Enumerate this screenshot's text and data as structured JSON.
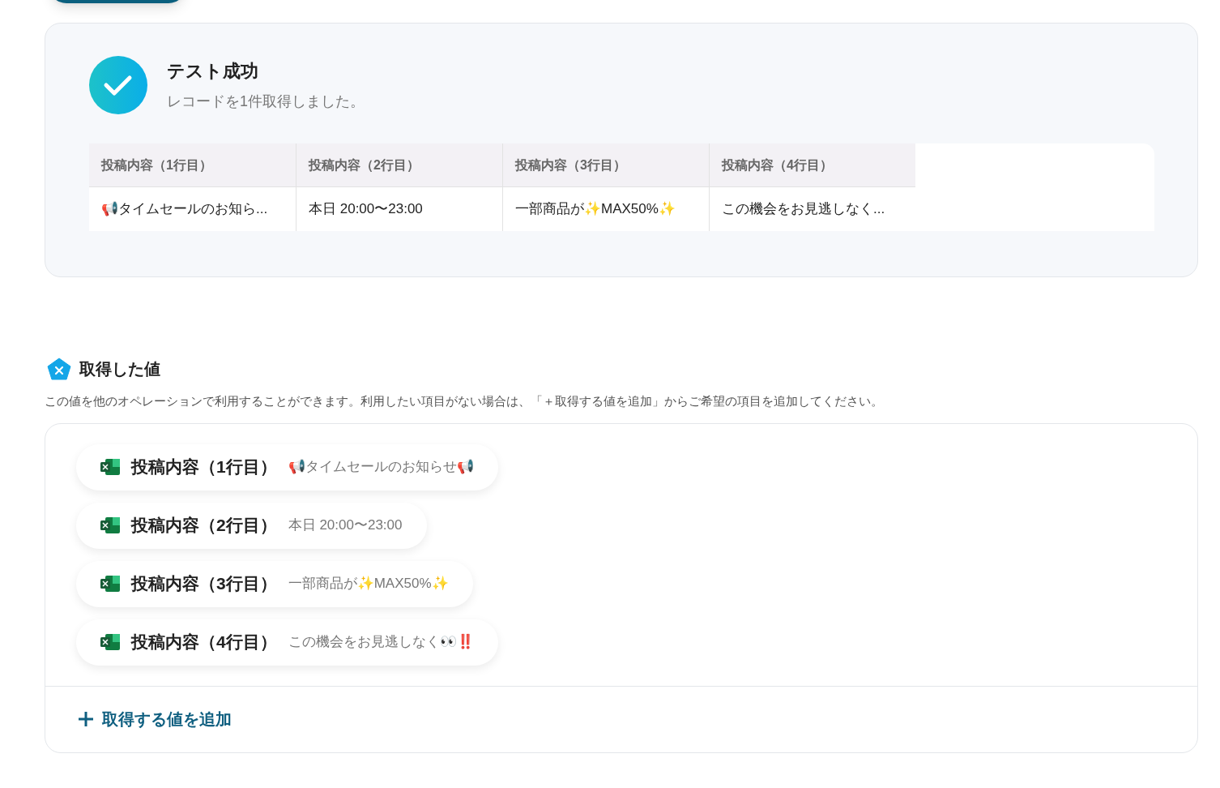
{
  "result": {
    "title": "テスト成功",
    "message": "レコードを1件取得しました。",
    "table": {
      "columns": [
        "投稿内容（1行目）",
        "投稿内容（2行目）",
        "投稿内容（3行目）",
        "投稿内容（4行目）"
      ],
      "rows": [
        [
          "📢タイムセールのお知ら...",
          "本日 20:00〜23:00",
          "一部商品が✨MAX50%✨",
          "この機会をお見逃しなく..."
        ]
      ]
    }
  },
  "values": {
    "title": "取得した値",
    "description": "この値を他のオペレーションで利用することができます。利用したい項目がない場合は、「＋取得する値を追加」からご希望の項目を追加してください。",
    "items": [
      {
        "label": "投稿内容（1行目）",
        "value": "📢タイムセールのお知らせ📢"
      },
      {
        "label": "投稿内容（2行目）",
        "value": "本日 20:00〜23:00"
      },
      {
        "label": "投稿内容（3行目）",
        "value": "一部商品が✨MAX50%✨"
      },
      {
        "label": "投稿内容（4行目）",
        "value": "この機会をお見逃しなく👀‼️"
      }
    ],
    "add_button": "取得する値を追加"
  }
}
